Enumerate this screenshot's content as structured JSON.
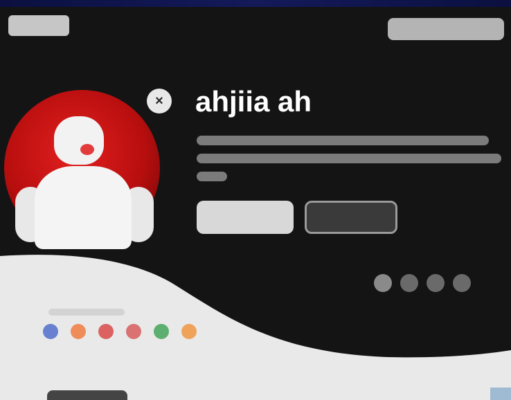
{
  "header": {
    "logo_text": "",
    "top_button_label": ""
  },
  "hero": {
    "close_label": "×",
    "title": "ahjiia ah",
    "description": "",
    "primary_button_label": "",
    "secondary_button_label": ""
  },
  "carousel": {
    "dots": [
      {
        "active": true
      },
      {
        "active": false
      },
      {
        "active": false
      },
      {
        "active": false
      }
    ]
  },
  "brands": {
    "colors": [
      "#3b5cc7",
      "#f06d2a",
      "#d73434",
      "#d44a4a",
      "#2e9b45",
      "#f08a2a"
    ]
  },
  "colors": {
    "background": "#141414",
    "accent_red": "#e21f1f",
    "light_panel": "#e9e9e9"
  }
}
